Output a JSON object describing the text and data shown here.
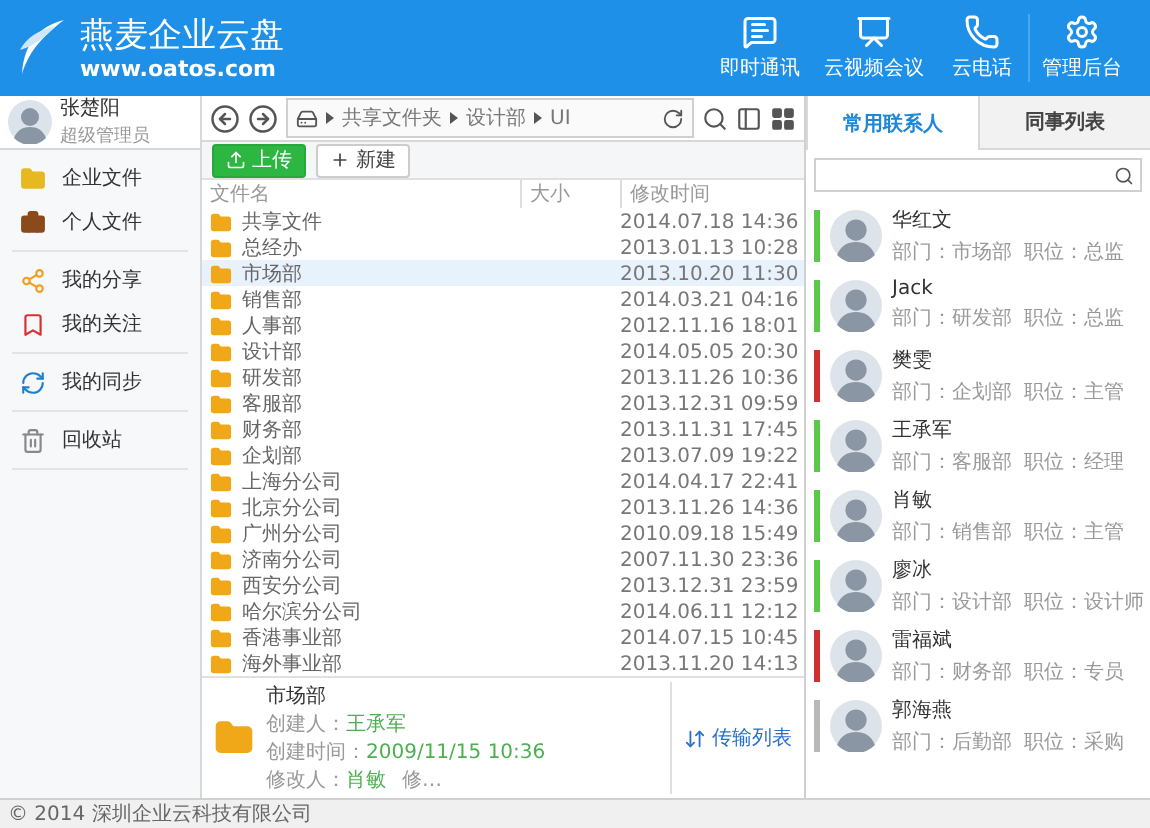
{
  "header": {
    "title": "燕麦企业云盘",
    "url": "www.oatos.com",
    "actions": [
      "即时通讯",
      "云视频会议",
      "云电话",
      "管理后台"
    ]
  },
  "user": {
    "name": "张楚阳",
    "role": "超级管理员"
  },
  "sidebar": {
    "groups": [
      [
        "企业文件",
        "个人文件"
      ],
      [
        "我的分享",
        "我的关注"
      ],
      [
        "我的同步"
      ],
      [
        "回收站"
      ]
    ]
  },
  "breadcrumb": [
    "共享文件夹",
    "设计部",
    "UI"
  ],
  "actions": {
    "upload": "上传",
    "new": "新建"
  },
  "columns": [
    "文件名",
    "大小",
    "修改时间"
  ],
  "files": [
    {
      "name": "共享文件",
      "modified": "2014.07.18 14:36",
      "selected": false
    },
    {
      "name": "总经办",
      "modified": "2013.01.13 10:28",
      "selected": false
    },
    {
      "name": "市场部",
      "modified": "2013.10.20 11:30",
      "selected": true
    },
    {
      "name": "销售部",
      "modified": "2014.03.21 04:16",
      "selected": false
    },
    {
      "name": "人事部",
      "modified": "2012.11.16 18:01",
      "selected": false
    },
    {
      "name": "设计部",
      "modified": "2014.05.05 20:30",
      "selected": false
    },
    {
      "name": "研发部",
      "modified": "2013.11.26 10:36",
      "selected": false
    },
    {
      "name": "客服部",
      "modified": "2013.12.31 09:59",
      "selected": false
    },
    {
      "name": "财务部",
      "modified": "2013.11.31 17:45",
      "selected": false
    },
    {
      "name": "企划部",
      "modified": "2013.07.09 19:22",
      "selected": false
    },
    {
      "name": "上海分公司",
      "modified": "2014.04.17 22:41",
      "selected": false
    },
    {
      "name": "北京分公司",
      "modified": "2013.11.26 14:36",
      "selected": false
    },
    {
      "name": "广州分公司",
      "modified": "2010.09.18 15:49",
      "selected": false
    },
    {
      "name": "济南分公司",
      "modified": "2007.11.30 23:36",
      "selected": false
    },
    {
      "name": "西安分公司",
      "modified": "2013.12.31 23:59",
      "selected": false
    },
    {
      "name": "哈尔滨分公司",
      "modified": "2014.06.11 12:12",
      "selected": false
    },
    {
      "name": "香港事业部",
      "modified": "2014.07.15 10:45",
      "selected": false
    },
    {
      "name": "海外事业部",
      "modified": "2013.11.20 14:13",
      "selected": false
    }
  ],
  "details": {
    "name": "市场部",
    "fields": [
      {
        "label": "创建人：",
        "value": "王承军"
      },
      {
        "label": "创建时间：",
        "value": "2009/11/15 10:36"
      },
      {
        "label": "修改人：",
        "value": "肖敏"
      }
    ],
    "more": "修…"
  },
  "transfer": "传输列表",
  "tabs": [
    {
      "label": "常用联系人",
      "selected": true
    },
    {
      "label": "同事列表",
      "selected": false
    }
  ],
  "contacts": [
    {
      "name": "华红文",
      "dept": "部门：市场部",
      "title": "职位：总监",
      "color": "#5cc84a"
    },
    {
      "name": "Jack",
      "dept": "部门：研发部",
      "title": "职位：总监",
      "color": "#5cc84a"
    },
    {
      "name": "樊雯",
      "dept": "部门：企划部",
      "title": "职位：主管",
      "color": "#d03030"
    },
    {
      "name": "王承军",
      "dept": "部门：客服部",
      "title": "职位：经理",
      "color": "#5cc84a"
    },
    {
      "name": "肖敏",
      "dept": "部门：销售部",
      "title": "职位：主管",
      "color": "#5cc84a"
    },
    {
      "name": "廖冰",
      "dept": "部门：设计部",
      "title": "职位：设计师",
      "color": "#5cc84a"
    },
    {
      "name": "雷福斌",
      "dept": "部门：财务部",
      "title": "职位：专员",
      "color": "#d03030"
    },
    {
      "name": "郭海燕",
      "dept": "部门：后勤部",
      "title": "职位：采购",
      "color": "#b8b8b8"
    }
  ],
  "footer": "© 2014 深圳企业云科技有限公司"
}
